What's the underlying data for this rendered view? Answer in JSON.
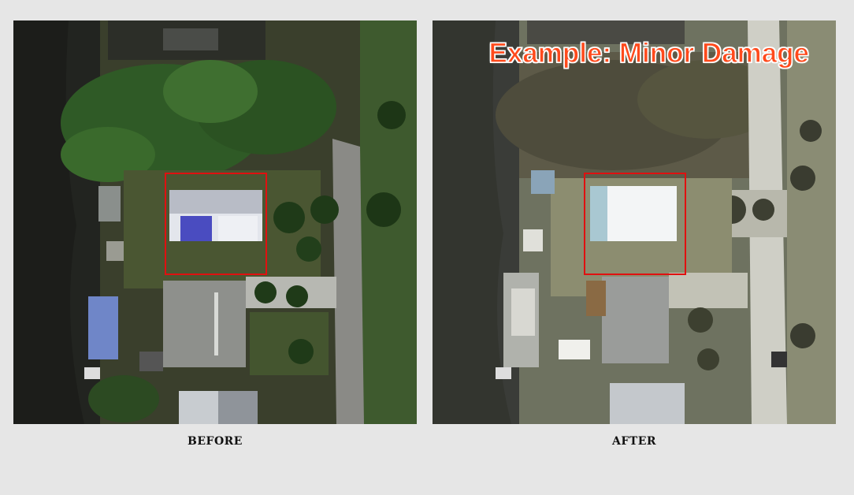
{
  "before": {
    "caption": "BEFORE"
  },
  "after": {
    "caption": "AFTER",
    "banner": "Example: Minor Damage"
  },
  "colors": {
    "highlight_box": "#e01010",
    "banner_text": "#ff4a1c",
    "banner_outline": "#ffffff",
    "background": "#e6e6e6"
  }
}
